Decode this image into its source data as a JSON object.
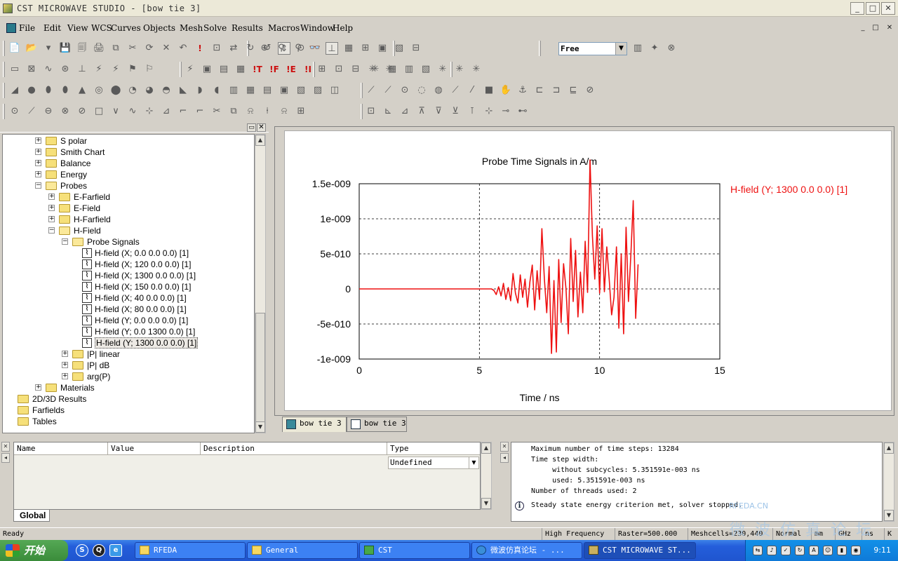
{
  "window": {
    "title": "CST MICROWAVE STUDIO - [bow tie 3]",
    "minimize": "_",
    "maximize": "□",
    "close": "✕"
  },
  "menu": [
    "File",
    "Edit",
    "View",
    "WCS",
    "Curves",
    "Objects",
    "Mesh",
    "Solve",
    "Results",
    "Macros",
    "Window",
    "Help"
  ],
  "mdi_controls": {
    "minimize": "_",
    "restore": "□",
    "close": "✕"
  },
  "toolbar": {
    "view_mode_value": "Free"
  },
  "toolbar_icons": {
    "row1": [
      "📄",
      "📂",
      "▾",
      "💾",
      "🗐",
      "🖨",
      "⧉",
      "✂",
      "⟳",
      "✕",
      "↶",
      "!",
      "⊡",
      "⇄",
      "↻",
      "↺",
      "⇕",
      "⊙",
      "⊕",
      "⚲",
      "⚲",
      "👓",
      "⊥",
      "▦",
      "⊞",
      "▣",
      "▧",
      "⊟",
      "▥",
      "✦",
      "⊗"
    ],
    "row2": [
      "▭",
      "⊠",
      "∿",
      "⊛",
      "⊥",
      "⚡",
      "⚡",
      "⚑",
      "⚐",
      "⚡",
      "▣",
      "▤",
      "▦",
      "!T",
      "!F",
      "!E",
      "!I",
      "⊞",
      "⊡",
      "⊟",
      "✳",
      "✳",
      "✳",
      "▦",
      "▥",
      "▧",
      "✳",
      "✳",
      "✳"
    ],
    "row3": [
      "◢",
      "●",
      "⬮",
      "⬮",
      "▲",
      "◎",
      "⬤",
      "◔",
      "◕",
      "◓",
      "◣",
      "◗",
      "◖",
      "▥",
      "▦",
      "▤",
      "▣",
      "▧",
      "▨",
      "◫",
      "⟋",
      "⟋",
      "⊙",
      "◌",
      "◍",
      "⟋",
      "⁄",
      "■",
      "✋",
      "⚓",
      "⊏",
      "⊐",
      "⊑",
      "⊘"
    ],
    "row4": [
      "⊙",
      "⟋",
      "⊖",
      "⊗",
      "⊘",
      "□",
      "∨",
      "∿",
      "⊹",
      "⊿",
      "⌐",
      "⌐",
      "✂",
      "⧉",
      "⍾",
      "⍿",
      "⍾",
      "⊞",
      "⊡",
      "⊾",
      "⊿",
      "⊼",
      "⊽",
      "⊻",
      "⊺",
      "⊹",
      "⊸",
      "⊷"
    ]
  },
  "tree": [
    {
      "label": "S polar",
      "level": 1,
      "expander": "+",
      "icon": "folder"
    },
    {
      "label": "Smith Chart",
      "level": 1,
      "expander": "+",
      "icon": "folder"
    },
    {
      "label": "Balance",
      "level": 1,
      "expander": "+",
      "icon": "folder"
    },
    {
      "label": "Energy",
      "level": 1,
      "expander": "+",
      "icon": "folder"
    },
    {
      "label": "Probes",
      "level": 1,
      "expander": "-",
      "icon": "folder-open"
    },
    {
      "label": "E-Farfield",
      "level": 2,
      "expander": "+",
      "icon": "folder"
    },
    {
      "label": "E-Field",
      "level": 2,
      "expander": "+",
      "icon": "folder"
    },
    {
      "label": "H-Farfield",
      "level": 2,
      "expander": "+",
      "icon": "folder"
    },
    {
      "label": "H-Field",
      "level": 2,
      "expander": "-",
      "icon": "folder-open"
    },
    {
      "label": "Probe Signals",
      "level": 3,
      "expander": "-",
      "icon": "folder-open"
    },
    {
      "label": "H-field (X; 0.0 0.0 0.0) [1]",
      "level": 4,
      "expander": "",
      "icon": "signal"
    },
    {
      "label": "H-field (X; 120 0.0 0.0) [1]",
      "level": 4,
      "expander": "",
      "icon": "signal"
    },
    {
      "label": "H-field (X; 1300 0.0 0.0) [1]",
      "level": 4,
      "expander": "",
      "icon": "signal"
    },
    {
      "label": "H-field (X; 150 0.0 0.0) [1]",
      "level": 4,
      "expander": "",
      "icon": "signal"
    },
    {
      "label": "H-field (X; 40 0.0 0.0) [1]",
      "level": 4,
      "expander": "",
      "icon": "signal"
    },
    {
      "label": "H-field (X; 80 0.0 0.0) [1]",
      "level": 4,
      "expander": "",
      "icon": "signal"
    },
    {
      "label": "H-field (Y; 0.0 0.0 0.0) [1]",
      "level": 4,
      "expander": "",
      "icon": "signal"
    },
    {
      "label": "H-field (Y; 0.0 1300 0.0) [1]",
      "level": 4,
      "expander": "",
      "icon": "signal"
    },
    {
      "label": "H-field (Y; 1300 0.0 0.0) [1]",
      "level": 4,
      "expander": "",
      "icon": "signal",
      "selected": true
    },
    {
      "label": "|P| linear",
      "level": 3,
      "expander": "+",
      "icon": "folder"
    },
    {
      "label": "|P| dB",
      "level": 3,
      "expander": "+",
      "icon": "folder"
    },
    {
      "label": "arg(P)",
      "level": 3,
      "expander": "+",
      "icon": "folder"
    },
    {
      "label": "Materials",
      "level": 1,
      "expander": "+",
      "icon": "folder"
    },
    {
      "label": "2D/3D Results",
      "level": 0,
      "expander": "",
      "icon": "folder"
    },
    {
      "label": "Farfields",
      "level": 0,
      "expander": "",
      "icon": "folder"
    },
    {
      "label": "Tables",
      "level": 0,
      "expander": "",
      "icon": "folder"
    }
  ],
  "plot_tabs": [
    "bow tie 3",
    "bow tie 3"
  ],
  "chart_data": {
    "type": "line",
    "title": "Probe Time Signals in A/m",
    "xlabel": "Time / ns",
    "ylabel": "",
    "xlim": [
      0,
      15
    ],
    "ylim": [
      -1e-09,
      1.5e-09
    ],
    "x_ticks": [
      0,
      5,
      10,
      15
    ],
    "x_tick_labels": [
      "0",
      "5",
      "10",
      "15"
    ],
    "y_ticks": [
      1.5e-09,
      1e-09,
      5e-10,
      0,
      -5e-10,
      -1e-09
    ],
    "y_tick_labels": [
      "1.5e-009",
      "1e-009",
      "5e-010",
      "0",
      "-5e-010",
      "-1e-009"
    ],
    "grid": true,
    "legend_position": "right",
    "series": [
      {
        "name": "H-field (Y; 1300 0.0 0.0) [1]",
        "color": "#ee1111",
        "x": [
          0,
          5.5,
          5.6,
          5.7,
          5.8,
          5.9,
          6.0,
          6.1,
          6.2,
          6.3,
          6.4,
          6.5,
          6.6,
          6.7,
          6.8,
          6.9,
          7.0,
          7.1,
          7.2,
          7.3,
          7.4,
          7.5,
          7.6,
          7.7,
          7.8,
          7.9,
          8.0,
          8.1,
          8.2,
          8.3,
          8.4,
          8.5,
          8.6,
          8.7,
          8.8,
          8.9,
          9.0,
          9.1,
          9.2,
          9.3,
          9.4,
          9.5,
          9.6,
          9.7,
          9.8,
          9.9,
          10.0,
          10.1,
          10.2,
          10.3,
          10.4,
          10.5,
          10.6,
          10.7,
          10.8,
          10.9,
          11.0,
          11.1,
          11.2,
          11.3,
          11.4,
          11.5,
          11.6
        ],
        "y": [
          0,
          0,
          -2e-11,
          -8e-11,
          3e-11,
          -1e-10,
          8e-11,
          -1.5e-10,
          2e-11,
          -1.7e-10,
          2.2e-10,
          -6e-11,
          -2e-10,
          2e-10,
          -1.2e-10,
          1.4e-10,
          -2.6e-10,
          1e-10,
          3.4e-10,
          -3e-10,
          2.6e-10,
          -1.5e-10,
          8.6e-10,
          1.5e-10,
          -3.4e-10,
          3.2e-10,
          -9.2e-10,
          1.2e-10,
          -9e-10,
          4.2e-10,
          -4.8e-10,
          3.6e-10,
          1e-11,
          -6.4e-10,
          7.2e-10,
          -1.8e-10,
          5.5e-10,
          -4e-10,
          2.4e-10,
          -3.4e-10,
          6.8e-10,
          -5e-11,
          1.84e-09,
          7.6e-10,
          1.4e-10,
          9e-10,
          -6e-11,
          8.6e-10,
          -4e-11,
          6e-10,
          1.3e-10,
          -3.7e-10,
          -1.2e-10,
          6e-10,
          -5.6e-10,
          5e-10,
          -6.4e-10,
          8.8e-10,
          -1.8e-10,
          4.8e-10,
          1.26e-09,
          -4.2e-10,
          3.5e-10
        ]
      }
    ]
  },
  "param_table": {
    "headers": [
      "Name",
      "Value",
      "Description",
      "Type"
    ],
    "type_value": "Undefined",
    "tab": "Global"
  },
  "messages": [
    "Maximum number of time steps: 13284",
    "Time step width:",
    "     without subcycles: 5.351591e-003 ns",
    "     used: 5.351591e-003 ns",
    "Number of threads used: 2",
    "Steady state energy criterion met, solver stopped."
  ],
  "statusbar": {
    "ready": "Ready",
    "solver": "High Frequency",
    "raster": "Raster=500.000",
    "meshcells": "Meshcells=230,440",
    "mode": "Normal",
    "unit_len": "mm",
    "unit_freq": "GHz",
    "unit_time": "ns",
    "unit_temp": "K"
  },
  "taskbar": {
    "start": "开始",
    "tasks": [
      {
        "label": "RFEDA",
        "icon": "folder"
      },
      {
        "label": "General",
        "icon": "folder"
      },
      {
        "label": "CST",
        "icon": "green"
      },
      {
        "label": "微波仿真论坛 - ...",
        "icon": "blue"
      },
      {
        "label": "CST MICROWAVE ST...",
        "icon": "cst"
      }
    ],
    "time": "9:11"
  },
  "watermark": {
    "small": "RFEDA.CN",
    "large": "微波仿真论坛"
  },
  "colors": {
    "accent": "#0a246a",
    "plot_line": "#ee1111",
    "taskbar": "#245edb"
  }
}
